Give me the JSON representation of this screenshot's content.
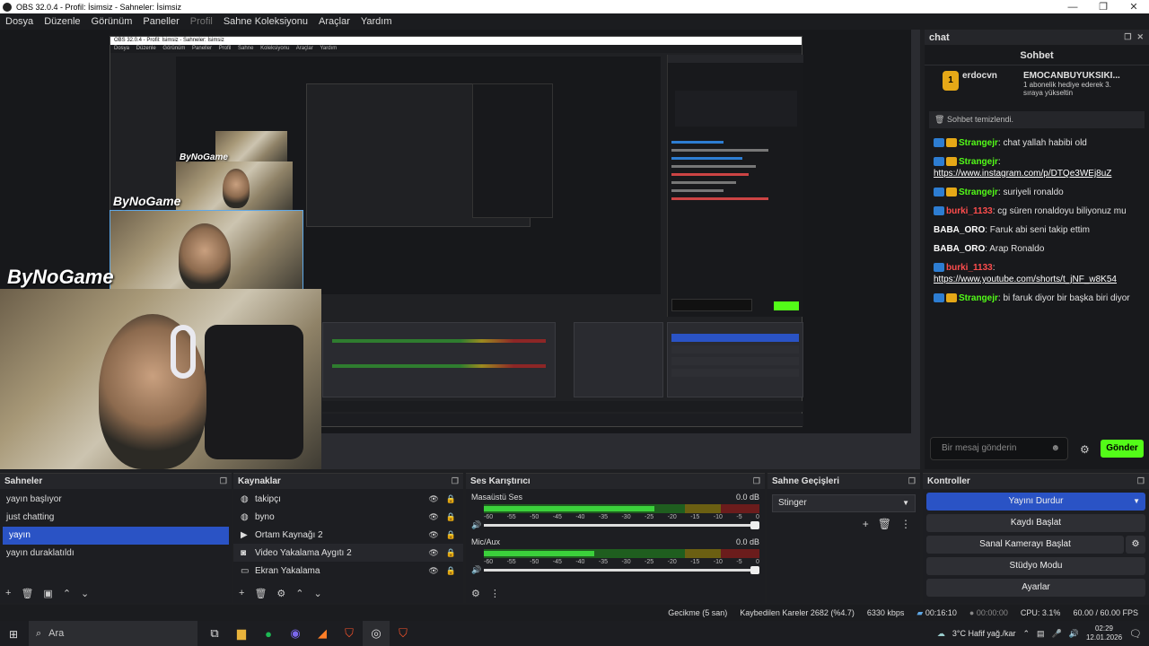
{
  "window": {
    "title": "OBS 32.0.4 - Profil: İsimsiz - Sahneler: İsimsiz"
  },
  "menu": [
    "Dosya",
    "Düzenle",
    "Görünüm",
    "Paneller",
    "Profil",
    "Sahne Koleksiyonu",
    "Araçlar",
    "Yardım"
  ],
  "preview": {
    "nested_title": "OBS 32.0.4 - Profil: İsimsiz - Sahneler: İsimsiz",
    "nested_menu": "Dosya Düzenle Görünüm Paneller Profil Sahne Koleksiyonu Araçlar Yardım",
    "watermark": "ByNoGame"
  },
  "chat": {
    "dock_title": "chat",
    "header": "Sohbet",
    "gift_user": "erdocvn",
    "gift_count": "1",
    "gift_target": "EMOCANBUYUKSIKI...",
    "gift_badge_count": "1",
    "gift_text": "1 abonelik hediye ederek 3. sıraya yükseltin",
    "cleared": "Sohbet temizlendi.",
    "messages": [
      {
        "user": "Strangejr",
        "text": "chat yallah habibi old"
      },
      {
        "user": "Strangejr",
        "text": "https://www.instagram.com/p/DTQe3WEj8uZ"
      },
      {
        "user": "Strangejr",
        "text": "suriyeli ronaldo"
      },
      {
        "user": "burki_1133",
        "text": "cg süren ronaldoyu biliyonuz mu"
      },
      {
        "user": "BABA_ORO",
        "text": "Faruk abi seni takip ettim"
      },
      {
        "user": "BABA_ORO",
        "text": "Arap Ronaldo"
      },
      {
        "user": "burki_1133",
        "text": "https://www.youtube.com/shorts/t_jNF_w8K54"
      },
      {
        "user": "Strangejr",
        "text": "bi faruk diyor bir başka biri diyor"
      }
    ],
    "input_placeholder": "Bir mesaj gönderin",
    "send_label": "Gönder"
  },
  "scenes": {
    "title": "Sahneler",
    "items": [
      "yayın başlıyor",
      "just chatting",
      "yayın",
      "yayın duraklatıldı"
    ],
    "selected": "yayın"
  },
  "sources": {
    "title": "Kaynaklar",
    "items": [
      "takipçı",
      "byno",
      "Ortam Kaynağı 2",
      "Video Yakalama Aygıtı 2",
      "Ekran Yakalama"
    ]
  },
  "mixer": {
    "title": "Ses Karıştırıcı",
    "channels": [
      {
        "name": "Masaüstü Ses",
        "db": "0.0 dB",
        "level": 0.62
      },
      {
        "name": "Mic/Aux",
        "db": "0.0 dB",
        "level": 0.4
      }
    ],
    "scale": [
      "-60",
      "-55",
      "-50",
      "-45",
      "-40",
      "-35",
      "-30",
      "-25",
      "-20",
      "-15",
      "-10",
      "-5",
      "0"
    ]
  },
  "transitions": {
    "title": "Sahne Geçişleri",
    "selected": "Stinger"
  },
  "controls": {
    "title": "Kontroller",
    "stop_stream": "Yayını Durdur",
    "start_record": "Kaydı Başlat",
    "virtual_cam": "Sanal Kamerayı Başlat",
    "studio_mode": "Stüdyo Modu",
    "settings": "Ayarlar"
  },
  "status": {
    "delay": "Gecikme (5 san)",
    "dropped": "Kaybedilen Kareler 2682 (%4.7)",
    "kbps": "6330 kbps",
    "stream_time": "00:16:10",
    "rec_time": "00:00:00",
    "cpu": "CPU: 3.1%",
    "fps": "60.00 / 60.00 FPS"
  },
  "taskbar": {
    "search": "Ara",
    "weather": "3°C  Hafif yağ./kar",
    "time": "02:29",
    "date": "12.01.2026"
  }
}
